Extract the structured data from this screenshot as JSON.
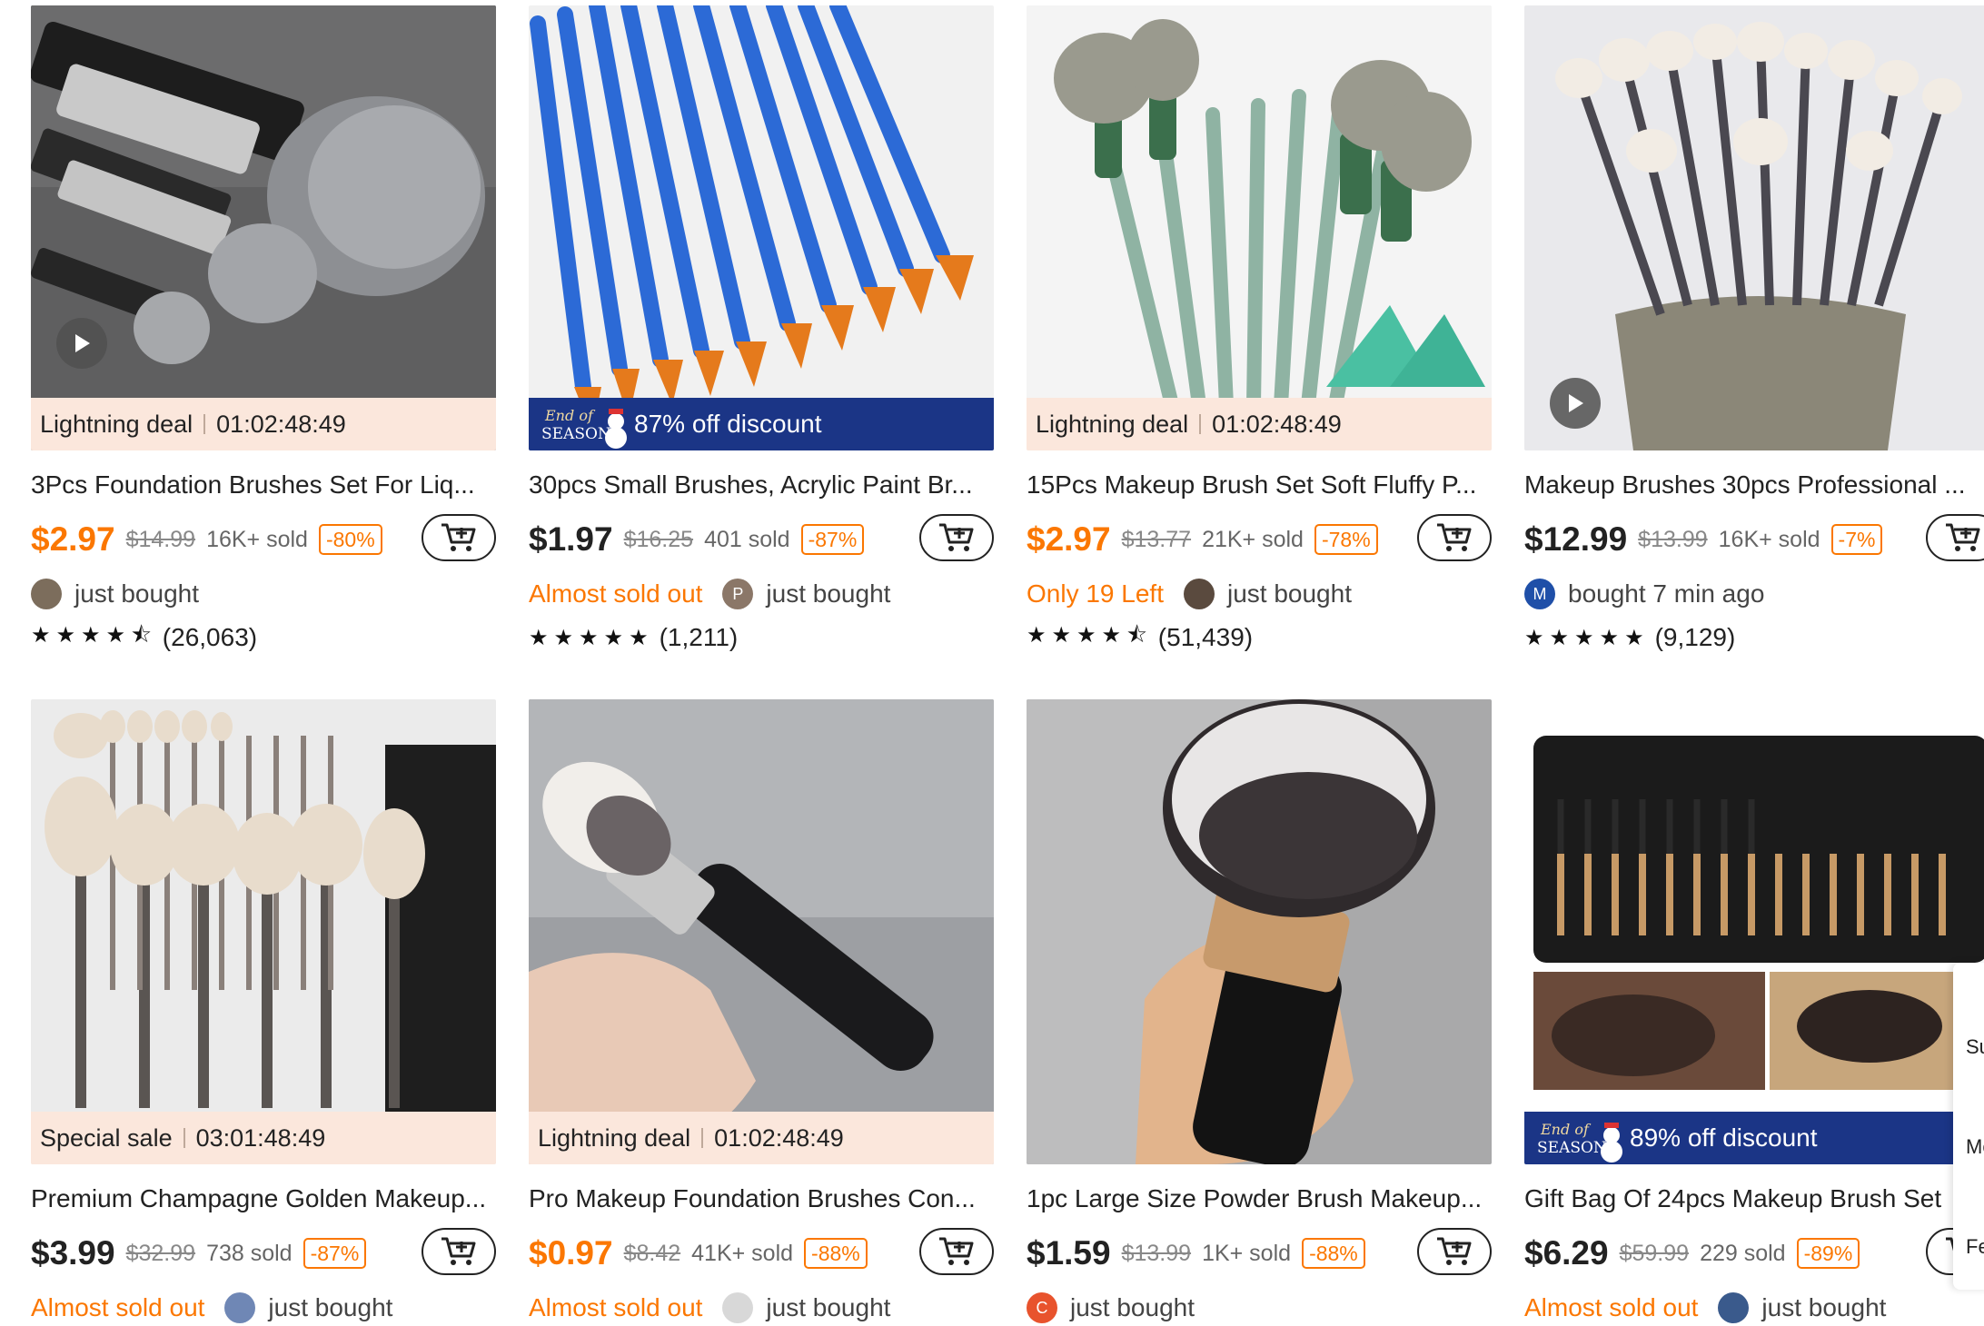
{
  "products": [
    {
      "title": "3Pcs Foundation Brushes Set For Liq...",
      "price": "$2.97",
      "price_color": "orange",
      "original_price": "$14.99",
      "sold": "16K+ sold",
      "discount": "-80%",
      "promo_type": "deal",
      "promo_label": "Lightning deal",
      "promo_timer": "01:02:48:49",
      "urgency": "",
      "buyer_avatar_text": "",
      "buyer_text": "just bought",
      "stars": "★★★★⯪",
      "reviews": "(26,063)",
      "has_video": true
    },
    {
      "title": "30pcs Small Brushes, Acrylic Paint Br...",
      "price": "$1.97",
      "price_color": "black",
      "original_price": "$16.25",
      "sold": "401 sold",
      "discount": "-87%",
      "promo_type": "season",
      "promo_label": "87% off discount",
      "promo_timer": "",
      "urgency": "Almost sold out",
      "buyer_avatar_text": "P",
      "buyer_text": "just bought",
      "stars": "★★★★★",
      "reviews": "(1,211)",
      "has_video": false
    },
    {
      "title": "15Pcs Makeup Brush Set Soft Fluffy P...",
      "price": "$2.97",
      "price_color": "orange",
      "original_price": "$13.77",
      "sold": "21K+ sold",
      "discount": "-78%",
      "promo_type": "deal",
      "promo_label": "Lightning deal",
      "promo_timer": "01:02:48:49",
      "urgency": "Only 19 Left",
      "buyer_avatar_text": "",
      "buyer_text": "just bought",
      "stars": "★★★★⯪",
      "reviews": "(51,439)",
      "has_video": false
    },
    {
      "title": "Makeup Brushes 30pcs Professional ...",
      "price": "$12.99",
      "price_color": "black",
      "original_price": "$13.99",
      "sold": "16K+ sold",
      "discount": "-7%",
      "promo_type": "none",
      "promo_label": "",
      "promo_timer": "",
      "urgency": "",
      "buyer_avatar_text": "M",
      "buyer_text": "bought 7 min ago",
      "stars": "★★★★★",
      "reviews": "(9,129)",
      "has_video": true
    },
    {
      "title": "Premium Champagne Golden Makeup...",
      "price": "$3.99",
      "price_color": "black",
      "original_price": "$32.99",
      "sold": "738 sold",
      "discount": "-87%",
      "promo_type": "deal",
      "promo_label": "Special sale",
      "promo_timer": "03:01:48:49",
      "urgency": "Almost sold out",
      "buyer_avatar_text": "",
      "buyer_text": "just bought",
      "stars": "",
      "reviews": "",
      "has_video": false
    },
    {
      "title": "Pro Makeup Foundation Brushes Con...",
      "price": "$0.97",
      "price_color": "orange",
      "original_price": "$8.42",
      "sold": "41K+ sold",
      "discount": "-88%",
      "promo_type": "deal",
      "promo_label": "Lightning deal",
      "promo_timer": "01:02:48:49",
      "urgency": "Almost sold out",
      "buyer_avatar_text": "",
      "buyer_text": "just bought",
      "stars": "",
      "reviews": "",
      "has_video": false
    },
    {
      "title": "1pc Large Size Powder Brush Makeup...",
      "price": "$1.59",
      "price_color": "black",
      "original_price": "$13.99",
      "sold": "1K+ sold",
      "discount": "-88%",
      "promo_type": "none",
      "promo_label": "",
      "promo_timer": "",
      "urgency": "",
      "buyer_avatar_text": "C",
      "buyer_text": "just bought",
      "stars": "",
      "reviews": "",
      "has_video": false
    },
    {
      "title": "Gift Bag Of 24pcs Makeup Brush Set",
      "price": "$6.29",
      "price_color": "orange",
      "original_price": "$59.99",
      "sold": "229 sold",
      "discount": "-89%",
      "promo_type": "season",
      "promo_label": "89% off discount",
      "promo_timer": "",
      "urgency": "Almost sold out",
      "buyer_avatar_text": "",
      "buyer_text": "just bought",
      "stars": "",
      "reviews": "",
      "has_video": false
    }
  ],
  "season_logo": {
    "line1": "End of",
    "line2": "SEASON"
  },
  "side_panel": {
    "label1": "Su",
    "label2": "Mo",
    "label3": "Fe"
  },
  "colors": {
    "accent": "#fb7701",
    "season_bg": "#1b3586",
    "deal_bg": "#fbe7dc"
  },
  "icons": {
    "cart": "add-to-cart-icon",
    "play": "play-icon"
  }
}
